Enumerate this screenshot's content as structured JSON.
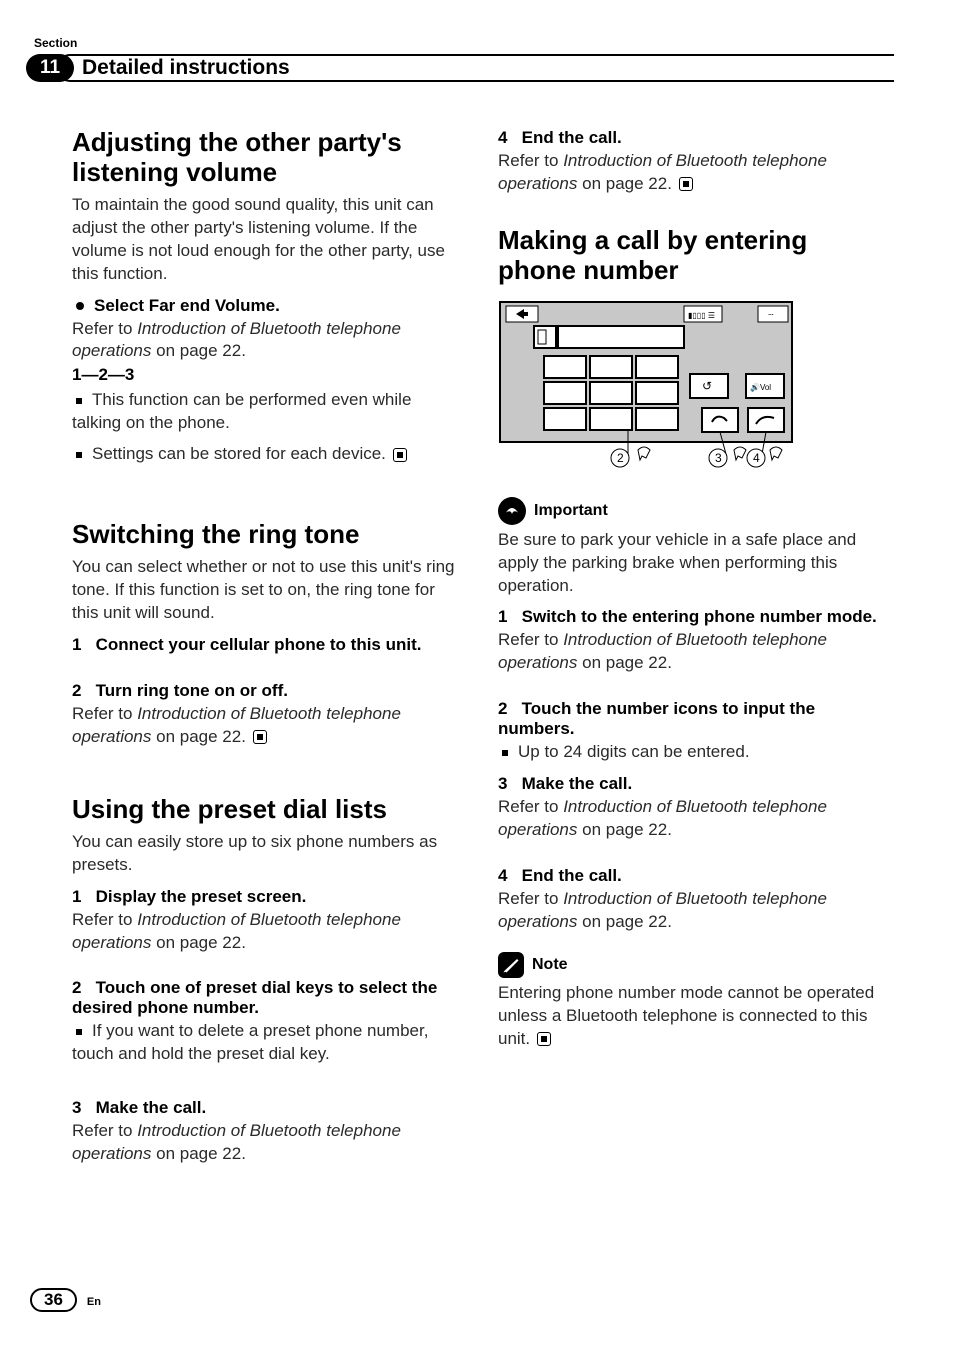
{
  "section": {
    "label": "Section",
    "number": "11",
    "title": "Detailed instructions"
  },
  "left": {
    "h1a": "Adjusting the other party's listening volume",
    "p1": "To maintain the good sound quality, this unit can adjust the other party's listening volume. If the volume is not loud enough for the other party, use this function.",
    "bullet_bold": "Select Far end Volume.",
    "refer1a": "Refer to ",
    "refer1i": "Introduction of Bluetooth telephone operations",
    "refer1b": " on page 22.",
    "dash": "1—2—3",
    "b1": "This function can be performed even while talking on the phone.",
    "b2": "Settings can be stored for each device.",
    "h1b": "Switching the ring tone",
    "p2": "You can select whether or not to use this unit's ring tone. If this function is set to on, the ring tone for this unit will sound.",
    "s1n": "1",
    "s1t": "Connect your cellular phone to this unit.",
    "s2n": "2",
    "s2t": "Turn ring tone on or off.",
    "refer2a": "Refer to ",
    "refer2i": "Introduction of Bluetooth telephone operations",
    "refer2b": " on page 22.",
    "h1c": "Using the preset dial lists",
    "p3": "You can easily store up to six phone numbers as presets.",
    "ps1n": "1",
    "ps1t": "Display the preset screen.",
    "refer3a": "Refer to ",
    "refer3i": "Introduction of Bluetooth telephone operations",
    "refer3b": " on page 22.",
    "ps2n": "2",
    "ps2t": "Touch one of preset dial keys to select the desired phone number.",
    "pb1": "If you want to delete a preset phone number, touch and hold the preset dial key.",
    "ps3n": "3",
    "ps3t": "Make the call.",
    "refer4a": "Refer to ",
    "refer4i": "Introduction of Bluetooth telephone operations",
    "refer4b": " on page 22."
  },
  "right": {
    "s4n": "4",
    "s4t": "End the call.",
    "refer5a": "Refer to ",
    "refer5i": "Introduction of Bluetooth telephone operations",
    "refer5b": " on page 22.",
    "h1d": "Making a call by entering phone number",
    "diagram": {
      "callouts": [
        "2",
        "3",
        "4"
      ],
      "labels": {
        "signal": "",
        "bt": "",
        "vol": "Vol"
      }
    },
    "important_label": "Important",
    "important_text": "Be sure to park your vehicle in a safe place and apply the parking brake when performing this operation.",
    "rs1n": "1",
    "rs1t": "Switch to the entering phone number mode.",
    "refer6a": "Refer to ",
    "refer6i": "Introduction of Bluetooth telephone operations",
    "refer6b": " on page 22.",
    "rs2n": "2",
    "rs2t": "Touch the number icons to input the numbers.",
    "rb1": "Up to 24 digits can be entered.",
    "rs3n": "3",
    "rs3t": "Make the call.",
    "refer7a": "Refer to ",
    "refer7i": "Introduction of Bluetooth telephone operations",
    "refer7b": " on page 22.",
    "rs4n": "4",
    "rs4t": "End the call.",
    "refer8a": "Refer to ",
    "refer8i": "Introduction of Bluetooth telephone operations",
    "refer8b": " on page 22.",
    "note_label": "Note",
    "note_text": "Entering phone number mode cannot be operated unless a Bluetooth telephone is connected to this unit."
  },
  "footer": {
    "page": "36",
    "lang": "En"
  }
}
